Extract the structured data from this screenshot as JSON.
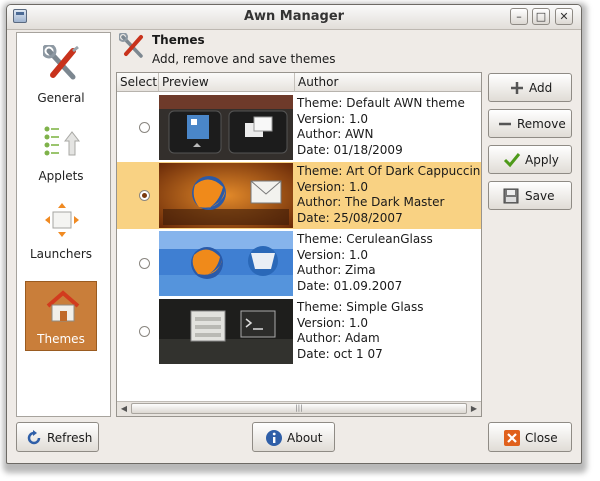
{
  "window": {
    "title": "Awn Manager"
  },
  "sidebar": {
    "items": [
      {
        "label": "General",
        "icon": "tools-icon",
        "active": false
      },
      {
        "label": "Applets",
        "icon": "applets-icon",
        "active": false
      },
      {
        "label": "Launchers",
        "icon": "launchers-icon",
        "active": false
      },
      {
        "label": "Themes",
        "icon": "home-icon",
        "active": true
      }
    ]
  },
  "header": {
    "title": "Themes",
    "subtitle": "Add, remove and save themes"
  },
  "table": {
    "columns": [
      "Select",
      "Preview",
      "Author"
    ],
    "rows": [
      {
        "selected": false,
        "theme": "Theme: Default AWN theme",
        "version": "Version: 1.0",
        "author": "Author: AWN",
        "date": "Date: 01/18/2009"
      },
      {
        "selected": true,
        "theme": "Theme: Art Of Dark Cappuccino",
        "version": "Version: 1.0",
        "author": "Author: The Dark Master",
        "date": "Date: 25/08/2007"
      },
      {
        "selected": false,
        "theme": "Theme: CeruleanGlass",
        "version": "Version: 1.0",
        "author": "Author: Zima",
        "date": "Date: 01.09.2007"
      },
      {
        "selected": false,
        "theme": "Theme: Simple Glass",
        "version": "Version: 1.0",
        "author": "Author: Adam",
        "date": "Date: oct 1 07"
      }
    ]
  },
  "actions": {
    "add": "Add",
    "remove": "Remove",
    "apply": "Apply",
    "save": "Save"
  },
  "footer": {
    "refresh": "Refresh",
    "about": "About",
    "close": "Close"
  },
  "colors": {
    "selection": "#f9d283",
    "sidebar_active": "#c97e3a",
    "window_bg": "#efebe7"
  }
}
